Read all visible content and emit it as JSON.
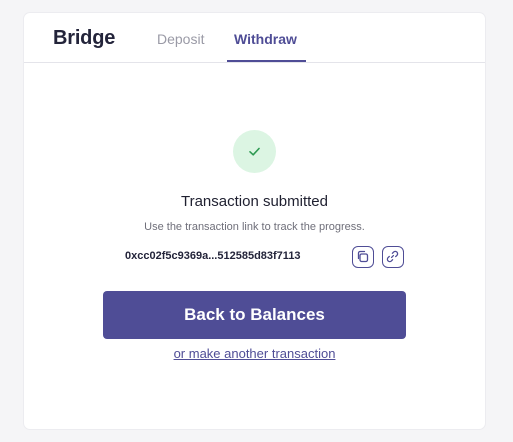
{
  "header": {
    "title": "Bridge",
    "tabs": [
      {
        "label": "Deposit",
        "active": false
      },
      {
        "label": "Withdraw",
        "active": true
      }
    ]
  },
  "status": {
    "icon": "check-icon",
    "title": "Transaction submitted",
    "subtitle": "Use the transaction link to track the progress."
  },
  "transaction": {
    "hash": "0xcc02f5c9369a...512585d83f7113",
    "copy_icon": "copy-icon",
    "link_icon": "link-icon"
  },
  "actions": {
    "primary_label": "Back to Balances",
    "secondary_label": "or make another transaction"
  },
  "colors": {
    "accent": "#4f4d96",
    "success_bg": "#dcf5e3",
    "success_check": "#2e9a52"
  }
}
